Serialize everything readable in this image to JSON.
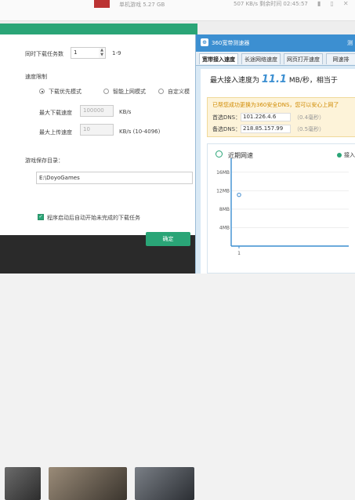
{
  "background": {
    "game_info": "单机游戏  5.27 GB",
    "speed_info": "507 KB/s  剩余时间 02:45:57",
    "icons": [
      "pause-icon",
      "folder-icon",
      "close-icon"
    ]
  },
  "settings": {
    "concurrent_label": "同时下载任务数",
    "concurrent_value": "1",
    "concurrent_range": "1-9",
    "speed_limit_label": "速度限制",
    "mode_download_priority": "下载优先模式",
    "mode_smart": "智能上网模式",
    "mode_custom": "自定义模",
    "max_download_label": "最大下载速度",
    "max_download_value": "100000",
    "max_download_unit": "KB/s",
    "max_upload_label": "最大上传速度",
    "max_upload_value": "10",
    "max_upload_unit": "KB/s (10-4096)",
    "save_dir_label": "游戏保存目录：",
    "save_dir_value": "E:\\DoyoGames",
    "autostart_label": "程序启动后自动开始未完成的下载任务",
    "confirm_label": "确定"
  },
  "speedtest": {
    "title": "360宽带测速器",
    "title_right": "测",
    "tabs": [
      "宽带接入速度",
      "长途网络速度",
      "网页打开速度",
      "网速排"
    ],
    "speed_prefix": "最大接入速度为",
    "speed_value": "11.1",
    "speed_suffix": "MB/秒，相当于",
    "dns_message": "已帮您成功更换为360安全DNS，您可以安心上网了",
    "primary_dns_label": "首选DNS：",
    "primary_dns_value": "101.226.4.6",
    "primary_dns_ms": "（0.4毫秒）",
    "secondary_dns_label": "备选DNS：",
    "secondary_dns_value": "218.85.157.99",
    "secondary_dns_ms": "（0.5毫秒）",
    "chart_title": "近期网速",
    "legend_label": "接入"
  },
  "chart_data": {
    "type": "scatter",
    "title": "近期网速",
    "ytick_labels": [
      "16MB",
      "12MB",
      "8MB",
      "4MB"
    ],
    "y_ticks": [
      16,
      12,
      8,
      4
    ],
    "x_tick_labels": [
      "1"
    ],
    "ylim": [
      0,
      18
    ],
    "series": [
      {
        "name": "接入",
        "x": [
          1
        ],
        "y": [
          11.1
        ]
      }
    ],
    "colors": {
      "series": "#5b9bd5",
      "axis": "#3c8fd1"
    }
  }
}
